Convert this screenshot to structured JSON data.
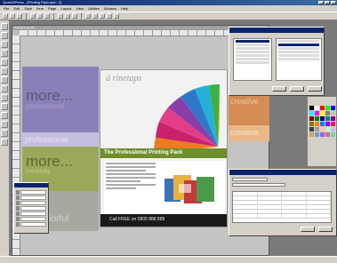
{
  "window": {
    "title": "QuarkXPress - [Printing Flyer.qxd : 1]",
    "controls": [
      "_",
      "□",
      "×"
    ]
  },
  "menu": {
    "items": [
      "File",
      "Edit",
      "Style",
      "Item",
      "Page",
      "Layout",
      "View",
      "Utilities",
      "Window",
      "Help"
    ]
  },
  "document": {
    "title": "Printing Flyer.qxd"
  },
  "layout": {
    "left_more_1": "more...",
    "left_professional_small": "professional",
    "left_professional_strip": "professional",
    "left_more_2": "more...",
    "left_more_2_sub": "creativity",
    "left_bottom_word": "colorful",
    "flyer_logo": "á rinetaps",
    "flyer_tagline": "",
    "flyer_headline": "The Professional Printing Pack",
    "flyer_footer": "Call FREE on 0800 888 888",
    "right_creative": "creative",
    "right_creative_strip": "creative"
  },
  "colors": {
    "purple": "#8b7fb8",
    "lilac": "#c6bede",
    "green": "#9aa85a",
    "orange": "#d48c55",
    "flyer_green": "#6f8f2a"
  },
  "swatches": [
    "#000000",
    "#ffffff",
    "#ff0000",
    "#00ff00",
    "#0000ff",
    "#00ffff",
    "#ff00ff",
    "#ffff00",
    "#808080",
    "#c0c0c0",
    "#800000",
    "#008000",
    "#000080",
    "#008080",
    "#800080",
    "#808000",
    "#ff8000",
    "#0080ff",
    "#8000ff",
    "#ff0080",
    "#404040",
    "#a0a0a0",
    "#ffc0c0",
    "#c0ffc0",
    "#c0c0ff",
    "#e0a060",
    "#60a0e0",
    "#a060e0",
    "#e060a0",
    "#60e0a0"
  ]
}
